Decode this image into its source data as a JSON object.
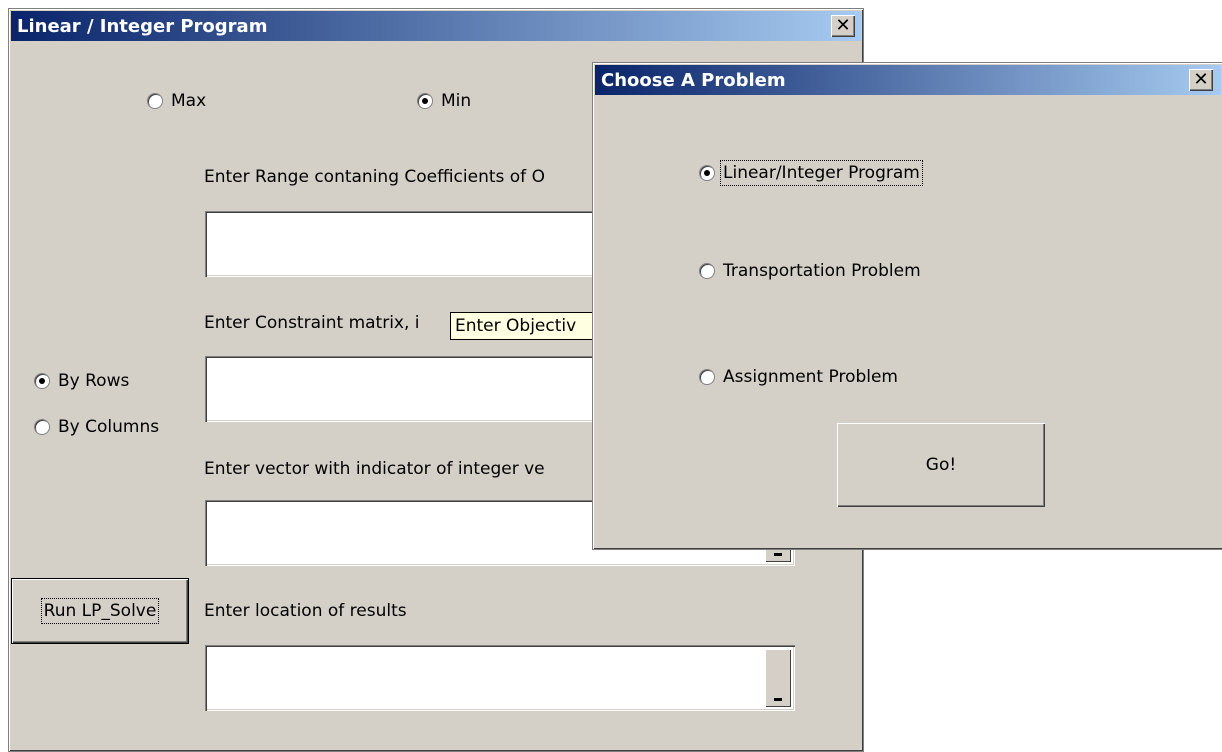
{
  "lp_window": {
    "title": "Linear / Integer Program",
    "close_glyph": "✕",
    "objective": {
      "max_label": "Max",
      "min_label": "Min",
      "selected": "Min"
    },
    "objective_range_label": "Enter Range contaning Coefficients of O",
    "constraint_label": "Enter Constraint matrix, i",
    "orientation": {
      "by_rows": "By Rows",
      "by_columns": "By Columns",
      "selected": "By Rows"
    },
    "integer_vector_label": "Enter vector with indicator of integer ve",
    "results_label": "Enter location of results",
    "run_button": "Run LP_Solve",
    "tooltip": "Enter Objectiv"
  },
  "choose_window": {
    "title": "Choose A Problem",
    "close_glyph": "✕",
    "options": [
      "Linear/Integer Program",
      "Transportation Problem",
      "Assignment Problem"
    ],
    "selected": "Linear/Integer Program",
    "go_button": "Go!"
  },
  "colors": {
    "face": "#d4d0c8",
    "title_start": "#0a246a",
    "title_end": "#a6caf0",
    "tooltip": "#ffffe1"
  }
}
